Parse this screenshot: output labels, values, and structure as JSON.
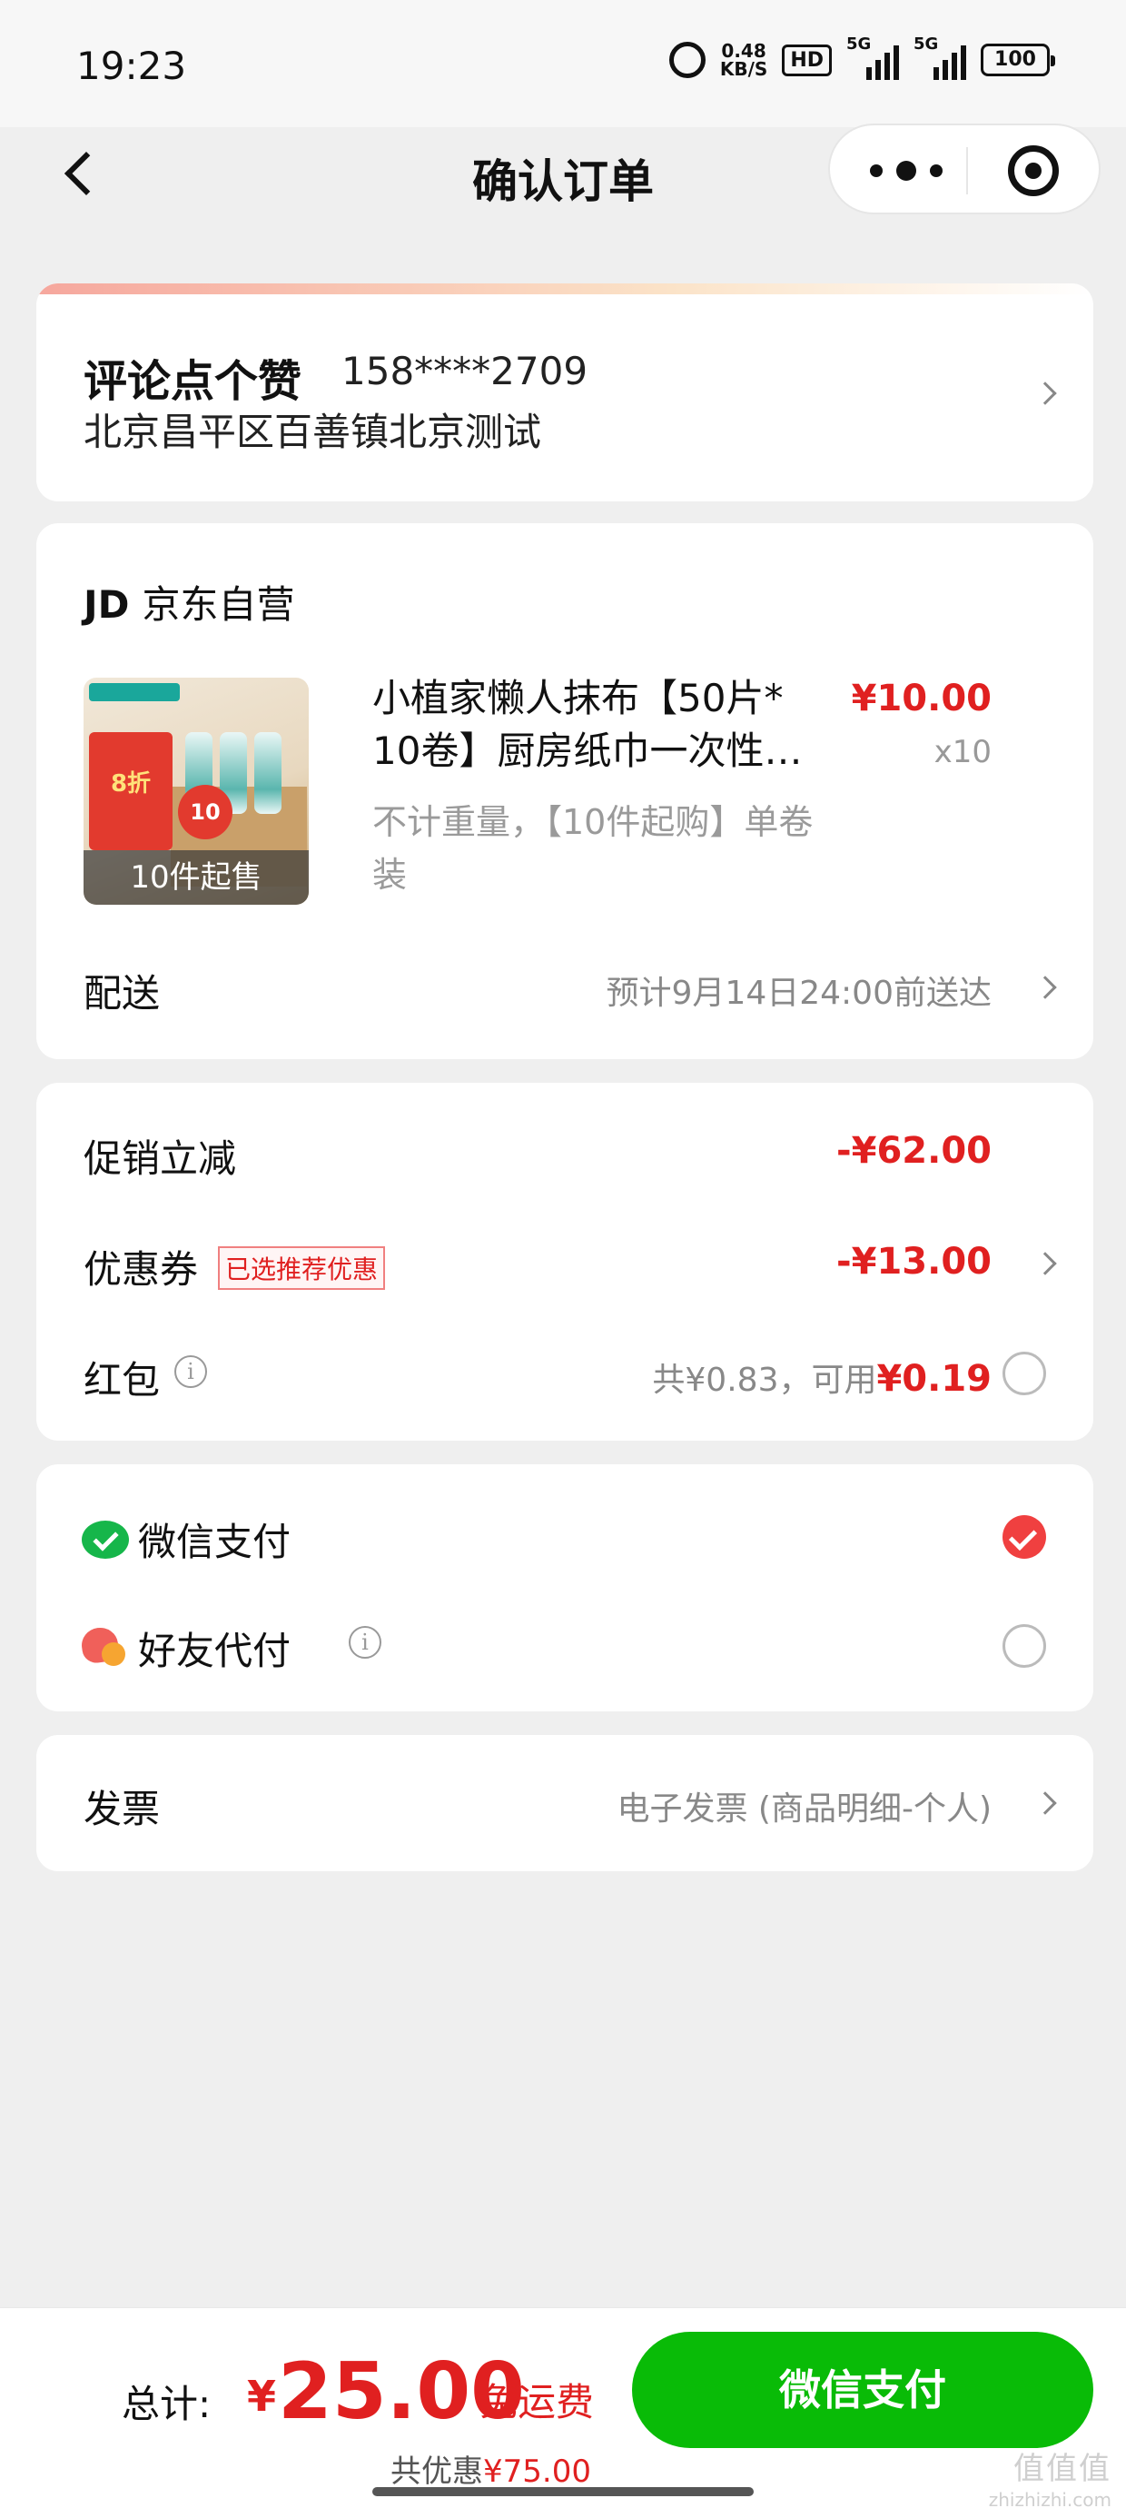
{
  "status_bar": {
    "time": "19:23",
    "net_speed_value": "0.48",
    "net_speed_unit": "KB/S",
    "hd": "HD",
    "signal1": "5G",
    "signal2": "5G",
    "battery": "100"
  },
  "nav": {
    "title": "确认订单",
    "icons": [
      "back-arrow-icon",
      "more-dots-icon",
      "target-icon"
    ]
  },
  "address": {
    "name": "评论点个赞",
    "phone": "158****2709",
    "line": "北京昌平区百善镇北京测试"
  },
  "shop": {
    "logo": "JD",
    "name": "京东自营"
  },
  "product": {
    "title_line1": "小植家懒人抹布【50片*",
    "title_line2": "10卷】厨房纸巾一次性…",
    "price": "¥10.00",
    "quantity": "x10",
    "spec_line1": "不计重量，【10件起购】单卷",
    "spec_line2": "装",
    "thumb_promo": "8折",
    "thumb_badge": "10",
    "thumb_moq": "10件起售"
  },
  "shipping": {
    "label": "配送",
    "value": "预计9月14日24:00前送达"
  },
  "discounts": {
    "promo_label": "促销立减",
    "promo_amount": "-¥62.00",
    "coupon_label": "优惠券",
    "coupon_tag": "已选推荐优惠",
    "coupon_amount": "-¥13.00",
    "hongbao_label": "红包",
    "hongbao_total": "共¥0.83，可用",
    "hongbao_available": "¥0.19"
  },
  "payment": {
    "wechat_label": "微信支付",
    "wechat_selected": true,
    "friend_label": "好友代付",
    "friend_selected": false
  },
  "invoice": {
    "label": "发票",
    "value": "电子发票 (商品明细-个人)"
  },
  "footer": {
    "total_label": "总计:",
    "currency": "¥",
    "total_amount": "25.00",
    "free_shipping": "免运费",
    "saved_prefix": "共优惠",
    "saved_amount": "¥75.00",
    "pay_button": "微信支付"
  },
  "watermark": {
    "text": "值值值",
    "sub": "zhizhizhi.com"
  },
  "colors": {
    "accent_red": "#e02020",
    "wechat_green": "#09bb07",
    "background": "#efefef"
  }
}
